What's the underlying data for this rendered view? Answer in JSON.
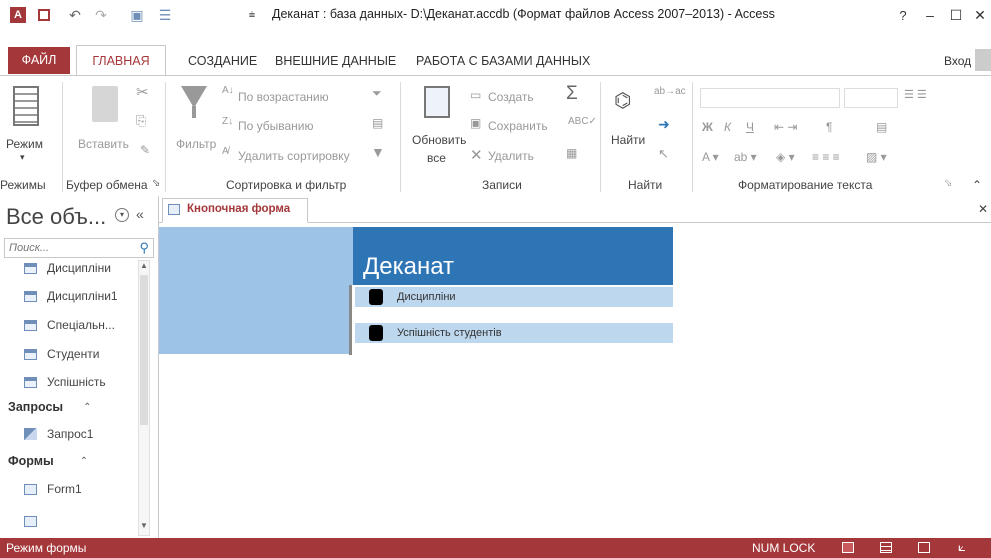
{
  "titlebar": {
    "title": "Деканат : база данных- D:\\Деканат.accdb (Формат файлов Access 2007–2013) - Access",
    "help": "?",
    "minimize": "–",
    "maximize": "☐",
    "close": "✕"
  },
  "tabs": {
    "file": "ФАЙЛ",
    "home": "ГЛАВНАЯ",
    "create": "СОЗДАНИЕ",
    "external": "ВНЕШНИЕ ДАННЫЕ",
    "database": "РАБОТА С БАЗАМИ ДАННЫХ",
    "signin": "Вход"
  },
  "ribbon": {
    "views": {
      "mode": "Режим",
      "group": "Режимы"
    },
    "clipboard": {
      "paste": "Вставить",
      "group": "Буфер обмена"
    },
    "sort": {
      "filter": "Фильтр",
      "asc": "По возрастанию",
      "desc": "По убыванию",
      "remove": "Удалить сортировку",
      "group": "Сортировка и фильтр"
    },
    "records": {
      "refresh1": "Обновить",
      "refresh2": "все",
      "new": "Создать",
      "save": "Сохранить",
      "delete": "Удалить",
      "group": "Записи"
    },
    "find": {
      "find": "Найти",
      "group": "Найти"
    },
    "format": {
      "bold": "Ж",
      "italic": "К",
      "underline": "Ч",
      "group": "Форматирование текста"
    }
  },
  "nav": {
    "title": "Все объ...",
    "search_placeholder": "Поиск...",
    "tables": [
      "Дисципліни",
      "Дисципліни1",
      "Спеціальн...",
      "Студенти",
      "Успішність"
    ],
    "queries_head": "Запросы",
    "queries": [
      "Запрос1"
    ],
    "forms_head": "Формы",
    "forms": [
      "Form1"
    ]
  },
  "document": {
    "tab_label": "Кнопочная форма",
    "form_title": "Деканат",
    "items": [
      "Дисципліни",
      "Успішність студентів"
    ]
  },
  "status": {
    "mode": "Режим формы",
    "numlock": "NUM LOCK"
  },
  "colors": {
    "accent": "#a4373a",
    "form_header": "#2e75b6",
    "form_left": "#9dc3e6",
    "item_bg": "#bdd7ee"
  }
}
